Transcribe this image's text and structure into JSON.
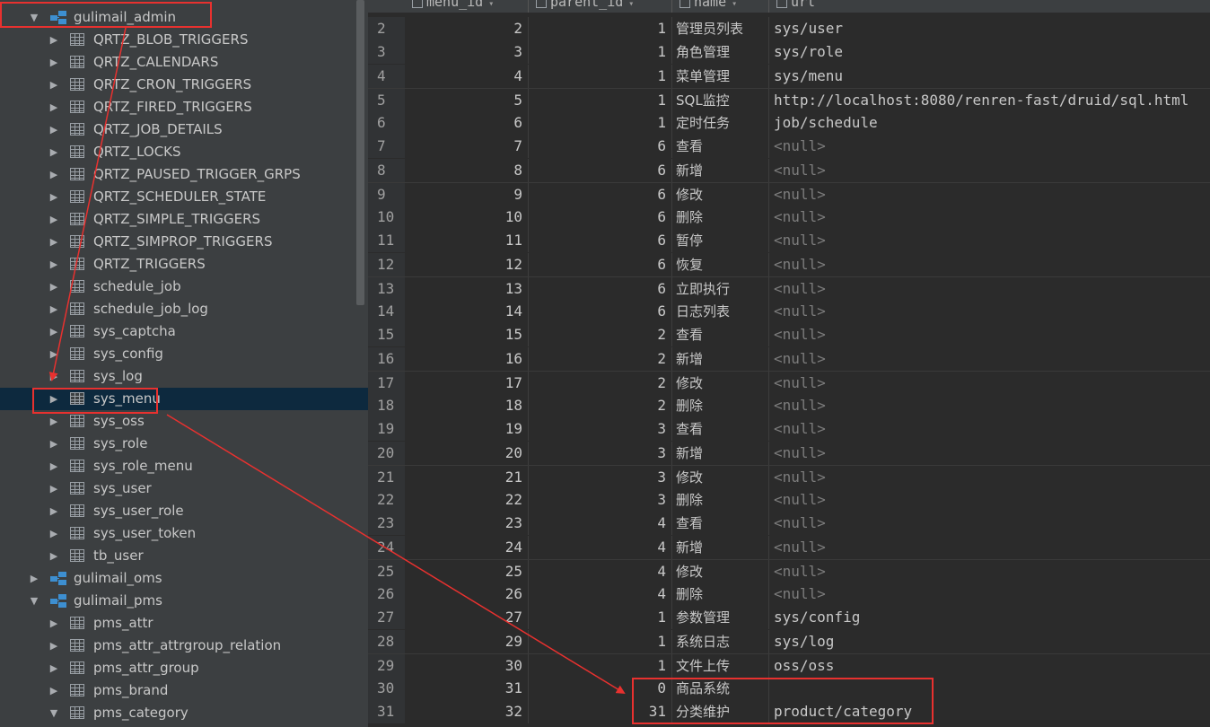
{
  "tree": {
    "items": [
      {
        "label": "gulimail_admin",
        "kind": "db",
        "expanded": true,
        "indent": 0
      },
      {
        "label": "QRTZ_BLOB_TRIGGERS",
        "kind": "table"
      },
      {
        "label": "QRTZ_CALENDARS",
        "kind": "table"
      },
      {
        "label": "QRTZ_CRON_TRIGGERS",
        "kind": "table"
      },
      {
        "label": "QRTZ_FIRED_TRIGGERS",
        "kind": "table"
      },
      {
        "label": "QRTZ_JOB_DETAILS",
        "kind": "table"
      },
      {
        "label": "QRTZ_LOCKS",
        "kind": "table"
      },
      {
        "label": "QRTZ_PAUSED_TRIGGER_GRPS",
        "kind": "table"
      },
      {
        "label": "QRTZ_SCHEDULER_STATE",
        "kind": "table"
      },
      {
        "label": "QRTZ_SIMPLE_TRIGGERS",
        "kind": "table"
      },
      {
        "label": "QRTZ_SIMPROP_TRIGGERS",
        "kind": "table"
      },
      {
        "label": "QRTZ_TRIGGERS",
        "kind": "table"
      },
      {
        "label": "schedule_job",
        "kind": "table"
      },
      {
        "label": "schedule_job_log",
        "kind": "table"
      },
      {
        "label": "sys_captcha",
        "kind": "table"
      },
      {
        "label": "sys_config",
        "kind": "table"
      },
      {
        "label": "sys_log",
        "kind": "table"
      },
      {
        "label": "sys_menu",
        "kind": "table",
        "selected": true
      },
      {
        "label": "sys_oss",
        "kind": "table"
      },
      {
        "label": "sys_role",
        "kind": "table"
      },
      {
        "label": "sys_role_menu",
        "kind": "table"
      },
      {
        "label": "sys_user",
        "kind": "table"
      },
      {
        "label": "sys_user_role",
        "kind": "table"
      },
      {
        "label": "sys_user_token",
        "kind": "table"
      },
      {
        "label": "tb_user",
        "kind": "table"
      },
      {
        "label": "gulimail_oms",
        "kind": "db",
        "expanded": false
      },
      {
        "label": "gulimail_pms",
        "kind": "db",
        "expanded": true
      },
      {
        "label": "pms_attr",
        "kind": "table"
      },
      {
        "label": "pms_attr_attrgroup_relation",
        "kind": "table"
      },
      {
        "label": "pms_attr_group",
        "kind": "table"
      },
      {
        "label": "pms_brand",
        "kind": "table"
      },
      {
        "label": "pms_category",
        "kind": "table",
        "expanded": true
      }
    ]
  },
  "grid": {
    "columns": [
      "menu_id",
      "parent_id",
      "name",
      "url"
    ],
    "rows": [
      {
        "n": "2",
        "id": "2",
        "pid": "1",
        "name": "管理员列表",
        "url": "sys/user"
      },
      {
        "n": "3",
        "id": "3",
        "pid": "1",
        "name": "角色管理",
        "url": "sys/role"
      },
      {
        "n": "4",
        "id": "4",
        "pid": "1",
        "name": "菜单管理",
        "url": "sys/menu"
      },
      {
        "n": "5",
        "id": "5",
        "pid": "1",
        "name": "SQL监控",
        "url": "http://localhost:8080/renren-fast/druid/sql.html"
      },
      {
        "n": "6",
        "id": "6",
        "pid": "1",
        "name": "定时任务",
        "url": "job/schedule"
      },
      {
        "n": "7",
        "id": "7",
        "pid": "6",
        "name": "查看",
        "url": "<null>"
      },
      {
        "n": "8",
        "id": "8",
        "pid": "6",
        "name": "新增",
        "url": "<null>"
      },
      {
        "n": "9",
        "id": "9",
        "pid": "6",
        "name": "修改",
        "url": "<null>"
      },
      {
        "n": "10",
        "id": "10",
        "pid": "6",
        "name": "删除",
        "url": "<null>"
      },
      {
        "n": "11",
        "id": "11",
        "pid": "6",
        "name": "暂停",
        "url": "<null>"
      },
      {
        "n": "12",
        "id": "12",
        "pid": "6",
        "name": "恢复",
        "url": "<null>"
      },
      {
        "n": "13",
        "id": "13",
        "pid": "6",
        "name": "立即执行",
        "url": "<null>"
      },
      {
        "n": "14",
        "id": "14",
        "pid": "6",
        "name": "日志列表",
        "url": "<null>"
      },
      {
        "n": "15",
        "id": "15",
        "pid": "2",
        "name": "查看",
        "url": "<null>"
      },
      {
        "n": "16",
        "id": "16",
        "pid": "2",
        "name": "新增",
        "url": "<null>"
      },
      {
        "n": "17",
        "id": "17",
        "pid": "2",
        "name": "修改",
        "url": "<null>"
      },
      {
        "n": "18",
        "id": "18",
        "pid": "2",
        "name": "删除",
        "url": "<null>"
      },
      {
        "n": "19",
        "id": "19",
        "pid": "3",
        "name": "查看",
        "url": "<null>"
      },
      {
        "n": "20",
        "id": "20",
        "pid": "3",
        "name": "新增",
        "url": "<null>"
      },
      {
        "n": "21",
        "id": "21",
        "pid": "3",
        "name": "修改",
        "url": "<null>"
      },
      {
        "n": "22",
        "id": "22",
        "pid": "3",
        "name": "删除",
        "url": "<null>"
      },
      {
        "n": "23",
        "id": "23",
        "pid": "4",
        "name": "查看",
        "url": "<null>"
      },
      {
        "n": "24",
        "id": "24",
        "pid": "4",
        "name": "新增",
        "url": "<null>"
      },
      {
        "n": "25",
        "id": "25",
        "pid": "4",
        "name": "修改",
        "url": "<null>"
      },
      {
        "n": "26",
        "id": "26",
        "pid": "4",
        "name": "删除",
        "url": "<null>"
      },
      {
        "n": "27",
        "id": "27",
        "pid": "1",
        "name": "参数管理",
        "url": "sys/config"
      },
      {
        "n": "28",
        "id": "29",
        "pid": "1",
        "name": "系统日志",
        "url": "sys/log"
      },
      {
        "n": "29",
        "id": "30",
        "pid": "1",
        "name": "文件上传",
        "url": "oss/oss"
      },
      {
        "n": "30",
        "id": "31",
        "pid": "0",
        "name": "商品系统",
        "url": ""
      },
      {
        "n": "31",
        "id": "32",
        "pid": "31",
        "name": "分类维护",
        "url": "product/category"
      }
    ]
  },
  "colors": {
    "accent_red": "#e8312f",
    "selection": "#0d293e",
    "db_icon": "#3d8fd1"
  }
}
